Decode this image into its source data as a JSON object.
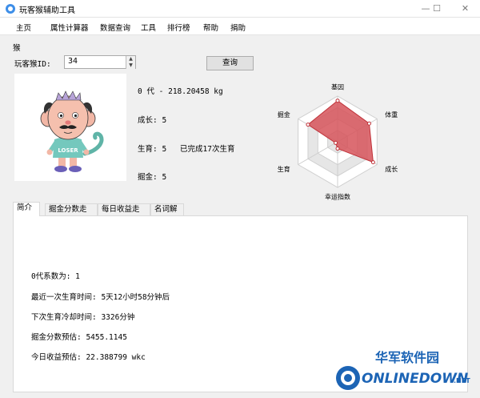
{
  "window": {
    "title": "玩客猴辅助工具",
    "minimize_glyph": "—",
    "maximize_glyph": "☐",
    "close_glyph": "✕"
  },
  "menu": [
    "主页",
    "属性计算器",
    "数据查询",
    "工具",
    "排行榜",
    "帮助",
    "捐助"
  ],
  "group": {
    "label": "猴"
  },
  "query": {
    "id_label": "玩客猴ID:",
    "id_value": "34",
    "button_label": "查询"
  },
  "monkey": {
    "shirt_text": "LOSER",
    "generation_weight": "0 代 - 218.20458 kg",
    "growth": "成长: 5",
    "breeding": "生育: 5",
    "breeding_done": "已完成17次生育",
    "mining": "掘金: 5"
  },
  "radar": {
    "labels": [
      "基因",
      "体重",
      "成长",
      "幸运指数",
      "生育",
      "掘金"
    ],
    "values": [
      0.9,
      0.8,
      0.9,
      0.15,
      0.05,
      0.75
    ],
    "grid_levels": 4,
    "fill_color": "#d6545a",
    "stroke_color": "#c0333a"
  },
  "tabs": [
    "简介",
    "掘金分数走势",
    "每日收益走势",
    "名词解释"
  ],
  "summary": {
    "coefficient": "0代系数为: 1",
    "last_breed": "最近一次生育时间: 5天12小时58分钟后",
    "cooldown": "下次生育冷却时间: 3326分钟",
    "score_estimate": "掘金分数预估: 5455.1145",
    "daily_income": "今日收益预估: 22.388799 wkc"
  },
  "watermark": {
    "cn_text": "华军软件园",
    "en_text": "ONLINEDOWN",
    "suffix": ".NET"
  }
}
